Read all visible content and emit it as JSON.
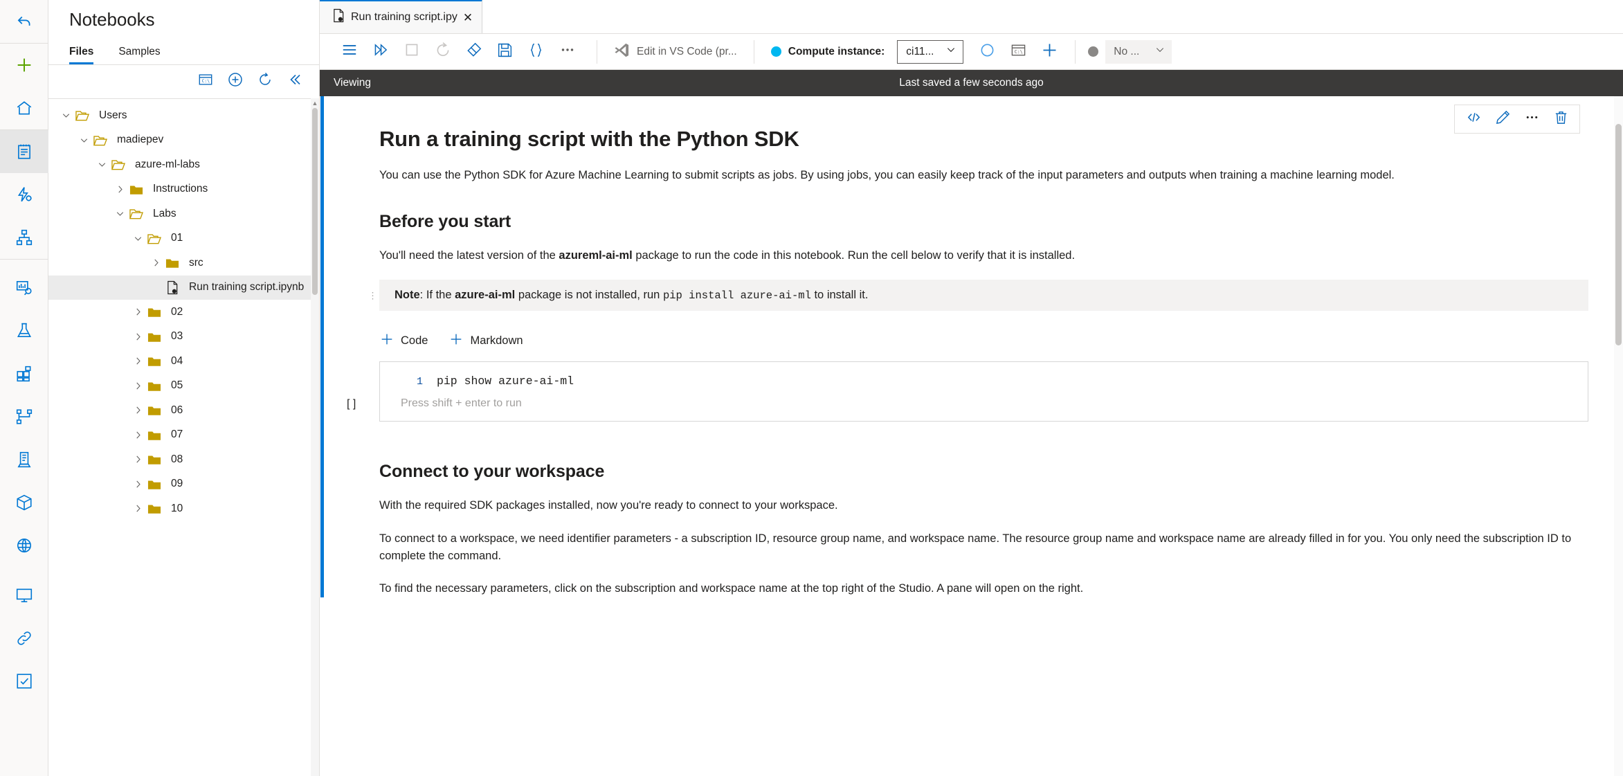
{
  "rail": {
    "items": [
      {
        "name": "back-arrow",
        "icon": "back-icon"
      },
      {
        "name": "create-new",
        "icon": "plus-icon"
      },
      {
        "name": "home",
        "icon": "home-icon"
      },
      {
        "name": "notebooks",
        "icon": "notebook-icon",
        "active": true
      },
      {
        "name": "automated-ml",
        "icon": "automated-ml-icon"
      },
      {
        "name": "designer",
        "icon": "designer-icon"
      },
      {
        "name": "data-monitoring",
        "icon": "data-monitor-icon"
      },
      {
        "name": "jobs",
        "icon": "flask-icon"
      },
      {
        "name": "components",
        "icon": "components-icon"
      },
      {
        "name": "pipelines",
        "icon": "pipelines-icon"
      },
      {
        "name": "environments",
        "icon": "environment-icon"
      },
      {
        "name": "models",
        "icon": "cube-icon"
      },
      {
        "name": "endpoints",
        "icon": "endpoint-icon"
      },
      {
        "name": "compute",
        "icon": "monitor-icon"
      },
      {
        "name": "linked-services",
        "icon": "link-icon"
      },
      {
        "name": "data-labeling",
        "icon": "labeling-icon"
      }
    ]
  },
  "filepane": {
    "title": "Notebooks",
    "tabs": [
      {
        "label": "Files",
        "selected": true
      },
      {
        "label": "Samples",
        "selected": false
      }
    ],
    "toolbar": [
      {
        "name": "terminal-button",
        "icon": "terminal-icon"
      },
      {
        "name": "add-files-button",
        "icon": "plus-circle-icon"
      },
      {
        "name": "refresh-button",
        "icon": "refresh-icon"
      },
      {
        "name": "collapse-button",
        "icon": "double-chevron-left-icon"
      }
    ],
    "tree": [
      {
        "label": "Users",
        "type": "folder-open",
        "indent": 0,
        "chevron": "down",
        "selected": false
      },
      {
        "label": "madiepev",
        "type": "folder-open",
        "indent": 1,
        "chevron": "down",
        "selected": false
      },
      {
        "label": "azure-ml-labs",
        "type": "folder-open",
        "indent": 2,
        "chevron": "down",
        "selected": false
      },
      {
        "label": "Instructions",
        "type": "folder-closed",
        "indent": 3,
        "chevron": "right",
        "selected": false
      },
      {
        "label": "Labs",
        "type": "folder-open",
        "indent": 3,
        "chevron": "down",
        "selected": false
      },
      {
        "label": "01",
        "type": "folder-open",
        "indent": 4,
        "chevron": "down",
        "selected": false
      },
      {
        "label": "src",
        "type": "folder-closed",
        "indent": 5,
        "chevron": "right",
        "selected": false
      },
      {
        "label": "Run training script.ipynb",
        "type": "notebook",
        "indent": 5,
        "chevron": "none",
        "selected": true
      },
      {
        "label": "02",
        "type": "folder-closed",
        "indent": 4,
        "chevron": "right",
        "selected": false
      },
      {
        "label": "03",
        "type": "folder-closed",
        "indent": 4,
        "chevron": "right",
        "selected": false
      },
      {
        "label": "04",
        "type": "folder-closed",
        "indent": 4,
        "chevron": "right",
        "selected": false
      },
      {
        "label": "05",
        "type": "folder-closed",
        "indent": 4,
        "chevron": "right",
        "selected": false
      },
      {
        "label": "06",
        "type": "folder-closed",
        "indent": 4,
        "chevron": "right",
        "selected": false
      },
      {
        "label": "07",
        "type": "folder-closed",
        "indent": 4,
        "chevron": "right",
        "selected": false
      },
      {
        "label": "08",
        "type": "folder-closed",
        "indent": 4,
        "chevron": "right",
        "selected": false
      },
      {
        "label": "09",
        "type": "folder-closed",
        "indent": 4,
        "chevron": "right",
        "selected": false
      },
      {
        "label": "10",
        "type": "folder-closed",
        "indent": 4,
        "chevron": "right",
        "selected": false
      }
    ]
  },
  "notebook_tab": {
    "label": "Run training script.ipy",
    "close_label": "✕"
  },
  "toolbar": {
    "buttons": [
      {
        "name": "toc-button",
        "icon": "hamburger-icon"
      },
      {
        "name": "run-all-button",
        "icon": "run-all-icon"
      },
      {
        "name": "stop-button",
        "icon": "stop-square-icon"
      },
      {
        "name": "restart-kernel-button",
        "icon": "restart-icon"
      },
      {
        "name": "clear-output-button",
        "icon": "eraser-icon"
      },
      {
        "name": "save-button",
        "icon": "save-icon"
      },
      {
        "name": "format-button",
        "icon": "braces-icon"
      },
      {
        "name": "more-button",
        "icon": "ellipsis-icon"
      }
    ],
    "vscode_label": "Edit in VS Code (pr...",
    "compute_label": "Compute instance:",
    "compute_dot_color": "#00b7f0",
    "compute_value": "ci11...",
    "compute_actions": [
      {
        "name": "compute-stop-button",
        "icon": "circle-outline-icon"
      },
      {
        "name": "compute-terminal-button",
        "icon": "terminal-icon"
      },
      {
        "name": "compute-new-button",
        "icon": "plus-icon"
      }
    ],
    "kernel_dot_color": "#8a8886",
    "kernel_value": "No ..."
  },
  "statusbar": {
    "mode": "Viewing",
    "saved": "Last saved a few seconds ago"
  },
  "cell_actions": [
    {
      "name": "view-source-button",
      "icon": "code-brackets-icon"
    },
    {
      "name": "edit-cell-button",
      "icon": "pencil-icon"
    },
    {
      "name": "cell-more-button",
      "icon": "ellipsis-icon"
    },
    {
      "name": "delete-cell-button",
      "icon": "trash-icon"
    }
  ],
  "content": {
    "h1": "Run a training script with the Python SDK",
    "p1": "You can use the Python SDK for Azure Machine Learning to submit scripts as jobs. By using jobs, you can easily keep track of the input parameters and outputs when training a machine learning model.",
    "h2_before": "Before you start",
    "p2_a": "You'll need the latest version of the ",
    "p2_b": "azureml-ai-ml",
    "p2_c": " package to run the code in this notebook. Run the cell below to verify that it is installed.",
    "note_label": "Note",
    "note_a": ": If the ",
    "note_pkg": "azure-ai-ml",
    "note_b": " package is not installed, run ",
    "note_code": "pip install azure-ai-ml",
    "note_c": " to install it.",
    "add_code_label": "Code",
    "add_markdown_label": "Markdown",
    "cell_lineno": "1",
    "cell_code": "pip show azure-ai-ml",
    "cell_hint": "Press shift + enter to run",
    "cell_exec": "[ ]",
    "h2_connect": "Connect to your workspace",
    "p3": "With the required SDK packages installed, now you're ready to connect to your workspace.",
    "p4": "To connect to a workspace, we need identifier parameters - a subscription ID, resource group name, and workspace name. The resource group name and workspace name are already filled in for you. You only need the subscription ID to complete the command.",
    "p5": "To find the necessary parameters, click on the subscription and workspace name at the top right of the Studio. A pane will open on the right."
  },
  "colors": {
    "accent": "#0078d4",
    "folder": "#c19c00",
    "statusbar_bg": "#3b3a39",
    "selected_row": "#ebebeb"
  }
}
